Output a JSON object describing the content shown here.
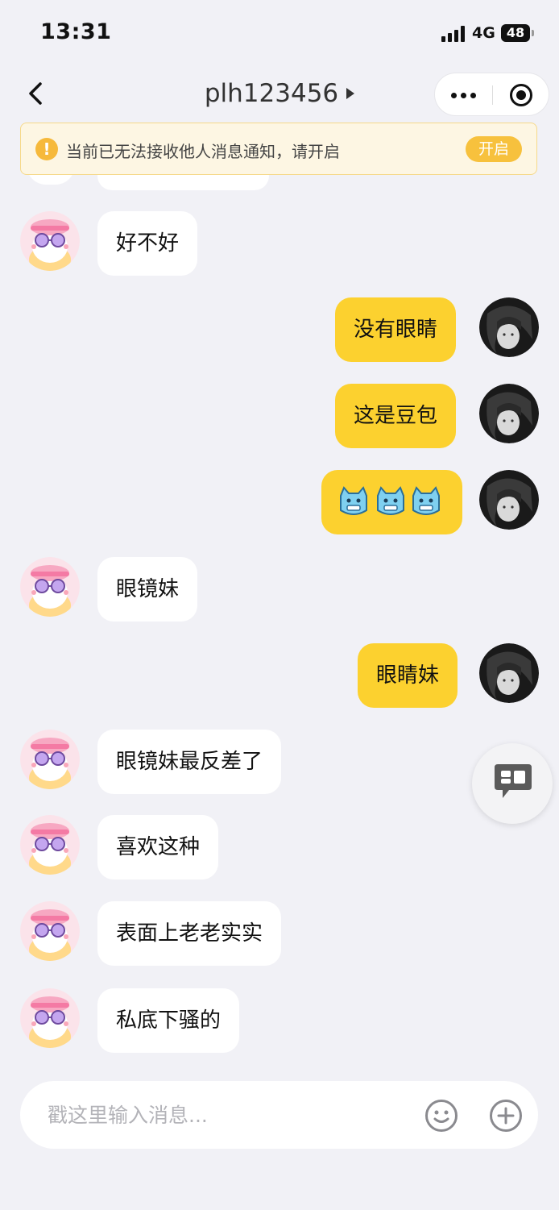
{
  "status_bar": {
    "time": "13:31",
    "network": "4G",
    "battery": "48"
  },
  "nav": {
    "title": "plh123456"
  },
  "notice": {
    "text": "当前已无法接收他人消息通知，请开启",
    "button": "开启"
  },
  "messages": [
    {
      "side": "in",
      "text": "好不好"
    },
    {
      "side": "out",
      "text": "没有眼睛"
    },
    {
      "side": "out",
      "text": "这是豆包"
    },
    {
      "side": "out",
      "text": "",
      "emoji": "cat-emoji x3"
    },
    {
      "side": "in",
      "text": "眼镜妹"
    },
    {
      "side": "out",
      "text": "眼睛妹"
    },
    {
      "side": "in",
      "text": "眼镜妹最反差了"
    },
    {
      "side": "in",
      "text": "喜欢这种"
    },
    {
      "side": "in",
      "text": "表面上老老实实"
    },
    {
      "side": "in",
      "text": "私底下骚的"
    }
  ],
  "input": {
    "placeholder": "戳这里输入消息..."
  },
  "icons": {
    "back": "chevron-left-icon",
    "more": "more-dots-icon",
    "close": "capsule-close-icon",
    "notice": "warning-icon",
    "float": "chat-bubble-icon",
    "emoji": "smiley-icon",
    "plus": "plus-circle-icon"
  },
  "colors": {
    "accent": "#fcd12f",
    "background": "#f1f1f6",
    "notice_bg": "#fdf6e3",
    "notice_button": "#f7c13d"
  }
}
